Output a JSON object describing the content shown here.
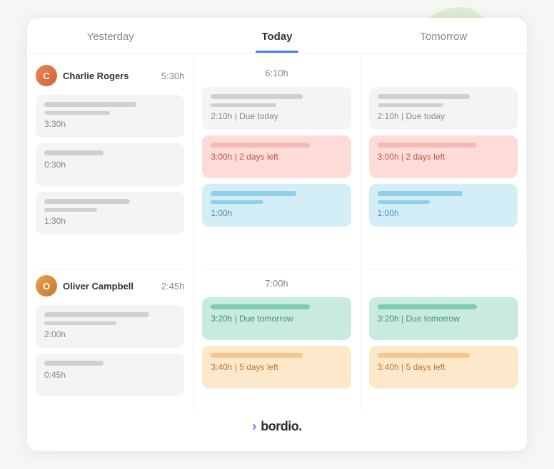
{
  "blobs": {},
  "header": {
    "col1": "Yesterday",
    "col2": "Today",
    "col3": "Tomorrow"
  },
  "charlie": {
    "name": "Charlie Rogers",
    "initials": "C",
    "yesterday_hours": "5:30h",
    "today_hours": "6:10h",
    "tomorrow_hours": "",
    "yesterday_cards": [
      {
        "bar_width": "70%",
        "label": "3:30h",
        "color": "gray"
      },
      {
        "bar_width": "45%",
        "label": "0:30h",
        "color": "gray"
      },
      {
        "bar_width": "65%",
        "label": "1:30h",
        "color": "gray"
      }
    ],
    "today_cards": [
      {
        "bar_width": "70%",
        "label": "2:10h | Due today",
        "color": "gray"
      },
      {
        "bar_width": "75%",
        "label": "3:00h | 2 days left",
        "color": "red"
      },
      {
        "bar_width": "65%",
        "label": "1:00h",
        "color": "blue"
      }
    ],
    "tomorrow_cards": [
      {
        "bar_width": "70%",
        "label": "2:10h | Due today",
        "color": "gray"
      },
      {
        "bar_width": "75%",
        "label": "3:00h | 2 days left",
        "color": "red"
      },
      {
        "bar_width": "65%",
        "label": "1:00h",
        "color": "blue"
      }
    ]
  },
  "oliver": {
    "name": "Oliver Campbell",
    "initials": "O",
    "yesterday_hours": "2:45h",
    "today_hours": "7:00h",
    "tomorrow_hours": "",
    "yesterday_cards": [
      {
        "bar_width": "80%",
        "label": "2:00h",
        "color": "gray"
      },
      {
        "bar_width": "45%",
        "label": "0:45h",
        "color": "gray"
      }
    ],
    "today_cards": [
      {
        "bar_width": "75%",
        "label": "3:20h | Due tomorrow",
        "color": "teal"
      },
      {
        "bar_width": "70%",
        "label": "3:40h | 5 days left",
        "color": "peach"
      }
    ],
    "tomorrow_cards": [
      {
        "bar_width": "75%",
        "label": "3:20h | Due tomorrow",
        "color": "teal"
      },
      {
        "bar_width": "70%",
        "label": "3:40h | 5 days left",
        "color": "peach"
      }
    ]
  },
  "footer": {
    "brand": "bordio.",
    "chevron": "›"
  }
}
